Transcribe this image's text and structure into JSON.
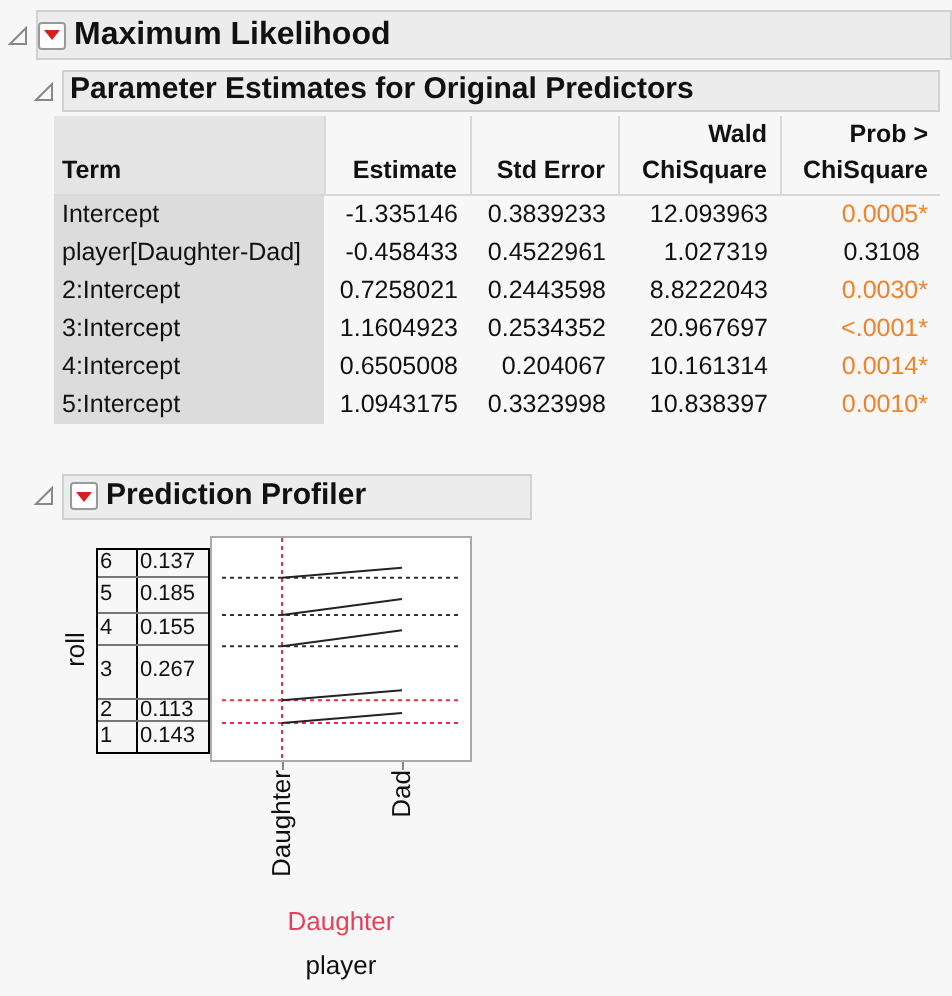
{
  "report": {
    "title": "Maximum Likelihood",
    "expanded": true
  },
  "estimates": {
    "title": "Parameter Estimates for Original Predictors",
    "expanded": true,
    "columns": [
      {
        "line2": "Term"
      },
      {
        "line2": "Estimate"
      },
      {
        "line2": "Std Error"
      },
      {
        "line1": "Wald",
        "line2": "ChiSquare"
      },
      {
        "line1": "Prob >",
        "line2": "ChiSquare"
      }
    ],
    "rows": [
      {
        "term": "Intercept",
        "estimate": "-1.335146",
        "std_error": "0.3839233",
        "chisquare": "12.093963",
        "prob": "0.0005*",
        "significant": true
      },
      {
        "term": "player[Daughter-Dad]",
        "estimate": "-0.458433",
        "std_error": "0.4522961",
        "chisquare": "1.027319",
        "prob": "0.3108",
        "significant": false
      },
      {
        "term": "2:Intercept",
        "estimate": "0.7258021",
        "std_error": "0.2443598",
        "chisquare": "8.8222043",
        "prob": "0.0030*",
        "significant": true
      },
      {
        "term": "3:Intercept",
        "estimate": "1.1604923",
        "std_error": "0.2534352",
        "chisquare": "20.967697",
        "prob": "<.0001*",
        "significant": true
      },
      {
        "term": "4:Intercept",
        "estimate": "0.6505008",
        "std_error": "0.204067",
        "chisquare": "10.161314",
        "prob": "0.0014*",
        "significant": true
      },
      {
        "term": "5:Intercept",
        "estimate": "1.0943175",
        "std_error": "0.3323998",
        "chisquare": "10.838397",
        "prob": "0.0010*",
        "significant": true
      }
    ]
  },
  "profiler": {
    "title": "Prediction Profiler",
    "expanded": true,
    "response": "roll",
    "levels": [
      {
        "level": "6",
        "prob": "0.137"
      },
      {
        "level": "5",
        "prob": "0.185"
      },
      {
        "level": "4",
        "prob": "0.155"
      },
      {
        "level": "3",
        "prob": "0.267"
      },
      {
        "level": "2",
        "prob": "0.113"
      },
      {
        "level": "1",
        "prob": "0.143"
      }
    ],
    "x_ticks": [
      "Daughter",
      "Dad"
    ],
    "current_value": "Daughter",
    "factor": "player"
  }
}
